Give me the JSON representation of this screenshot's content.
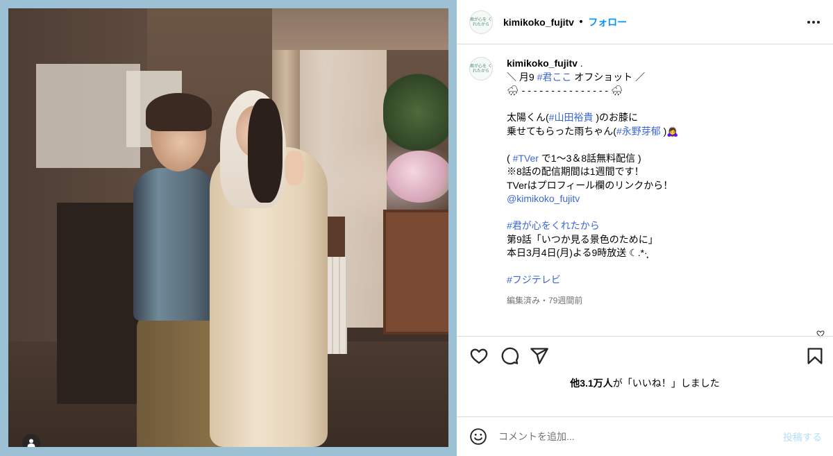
{
  "header": {
    "username": "kimikoko_fujitv",
    "separator": "•",
    "follow_label": "フォロー",
    "avatar_text": "君が心を くれたから"
  },
  "caption": {
    "username": "kimikoko_fujitv",
    "username_suffix": " .",
    "lines": {
      "l1_pre": "＼ 月9 ",
      "l1_tag": "#君ここ",
      "l1_post": " オフショット ／",
      "l2": "🌧 - - - - - - - - - - - - - - - 🌧",
      "l3": "太陽くん(",
      "l3_tag": "#山田裕貴",
      "l3_post": " )のお膝に",
      "l4_pre": "乗せてもらった雨ちゃん(",
      "l4_tag": "#永野芽郁",
      "l4_post": " )🙇‍♀️",
      "l5_pre": "( ",
      "l5_tag": "#TVer",
      "l5_post": " で1〜3＆8話無料配信 )",
      "l6": "※8話の配信期間は1週間です！",
      "l7": "TVerはプロフィール欄のリンクから！",
      "l8_mention": "@kimikoko_fujitv",
      "l9_tag": "#君が心をくれたから",
      "l10": "第9話「いつか見る景色のために」",
      "l11": "本日3月4日(月)よる9時放送 ☾.*·̩͙",
      "l12_tag": "#フジテレビ"
    },
    "edited": "編集済み・79週間前"
  },
  "likes": {
    "count": "他3.1万人",
    "suffix": "が「いいね！」しました"
  },
  "comment": {
    "placeholder": "コメントを追加...",
    "post_label": "投稿する"
  },
  "icons": {
    "like": "heart-icon",
    "comment": "comment-icon",
    "share": "share-icon",
    "save": "bookmark-icon",
    "emoji": "emoji-icon",
    "more": "more-icon",
    "user_tag": "user-tag-icon"
  },
  "colors": {
    "link": "#0095f6",
    "hashtag": "#3a66d8",
    "post_disabled": "#b2dffc",
    "frame": "#9cc1d4"
  }
}
